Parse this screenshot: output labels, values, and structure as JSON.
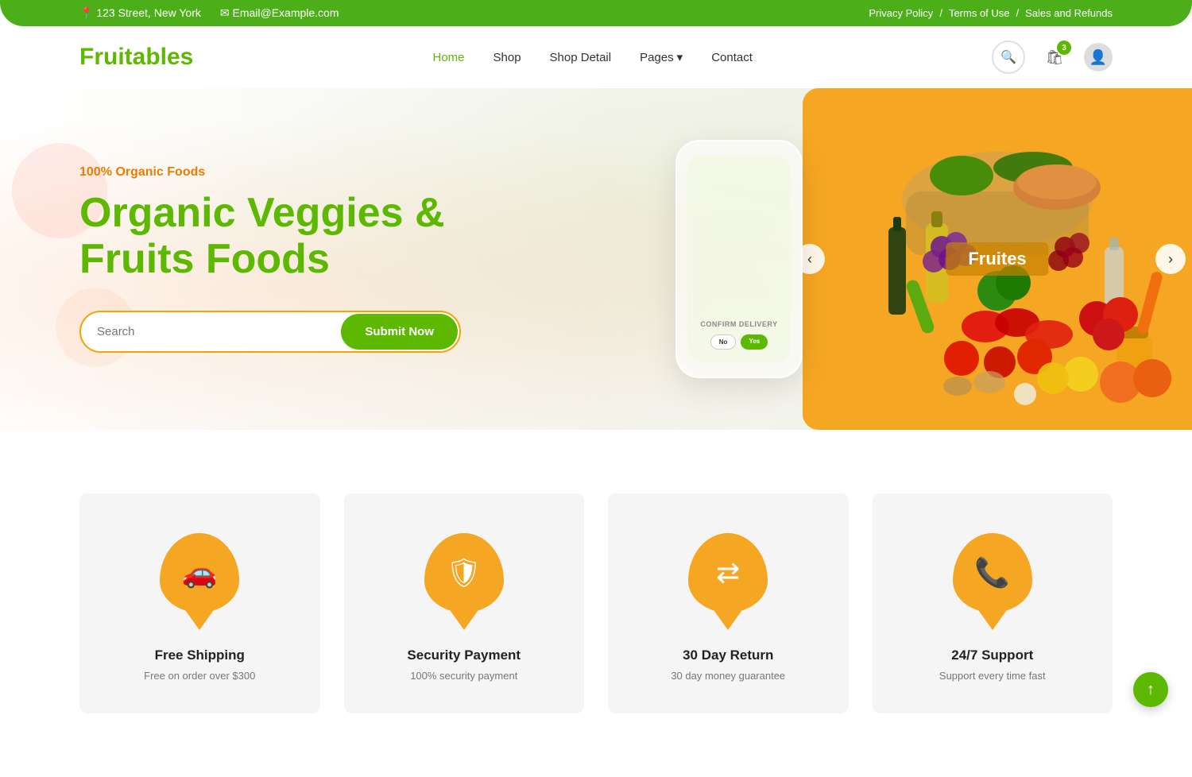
{
  "topbar": {
    "address": "123 Street, New York",
    "email": "Email@Example.com",
    "links": [
      "Privacy Policy",
      "Terms of Use",
      "Sales and Refunds"
    ],
    "separator": "/"
  },
  "header": {
    "logo": "Fruitables",
    "nav": [
      {
        "label": "Home",
        "active": true
      },
      {
        "label": "Shop",
        "active": false
      },
      {
        "label": "Shop Detail",
        "active": false
      },
      {
        "label": "Pages",
        "active": false,
        "hasDropdown": true
      },
      {
        "label": "Contact",
        "active": false
      }
    ],
    "cart_count": "3"
  },
  "hero": {
    "tag": "100% Organic Foods",
    "title": "Organic Veggies & Fruits Foods",
    "search_placeholder": "Search",
    "search_button": "Submit Now",
    "phone_confirm": "CONFIRM DELIVERY",
    "phone_btn_no": "No",
    "phone_btn_yes": "Yes",
    "fruit_label": "Fruites",
    "nav_left": "‹",
    "nav_right": "›"
  },
  "features": [
    {
      "icon": "🚗",
      "title": "Free Shipping",
      "desc": "Free on order over $300"
    },
    {
      "icon": "🛡",
      "title": "Security Payment",
      "desc": "100% security payment"
    },
    {
      "icon": "⇄",
      "title": "30 Day Return",
      "desc": "30 day money guarantee"
    },
    {
      "icon": "📞",
      "title": "24/7 Support",
      "desc": "Support every time fast"
    }
  ],
  "scroll_top": "↑"
}
